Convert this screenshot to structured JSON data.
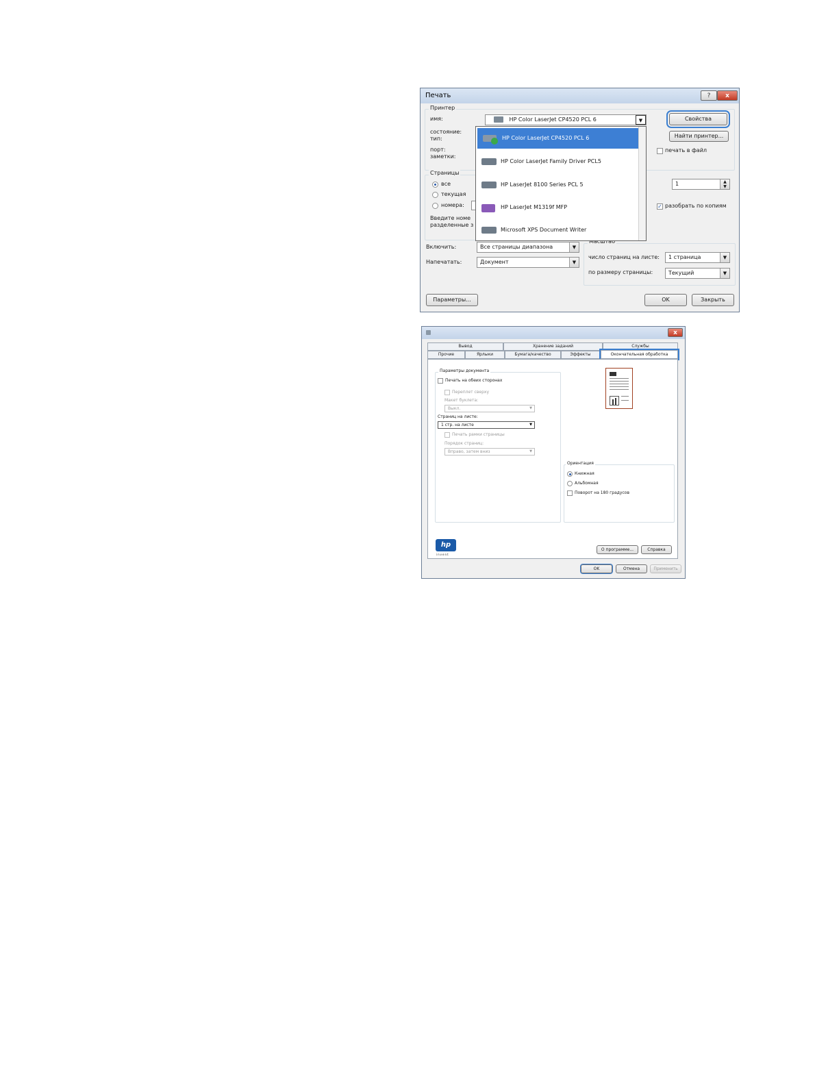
{
  "print_dialog": {
    "title": "Печать",
    "help_button": "?",
    "close_button": "x",
    "printer_group": "Принтер",
    "name_label": "имя:",
    "status_label": "состояние:",
    "type_label": "тип:",
    "port_label": "порт:",
    "notes_label": "заметки:",
    "selected_printer": "HP Color LaserJet CP4520 PCL 6",
    "properties_button": "Свойства",
    "find_printer_button": "Найти принтер...",
    "print_to_file": "печать в файл",
    "pages_group": "Страницы",
    "pages_all": "все",
    "pages_current": "текущая",
    "pages_numbers": "номера:",
    "hint_line1": "Введите номе",
    "hint_line2": "разделенные з",
    "copies_value": "1",
    "collate": "разобрать по копиям",
    "include_label": "Включить:",
    "include_value": "Все страницы диапазона",
    "print_what_label": "Напечатать:",
    "print_what_value": "Документ",
    "scale_group": "Масштаб",
    "pages_per_sheet_label": "число страниц на листе:",
    "pages_per_sheet_value": "1 страница",
    "fit_to_label": "по размеру страницы:",
    "fit_to_value": "Текущий",
    "options_button": "Параметры...",
    "ok_button": "OK",
    "close_dialog_button": "Закрыть",
    "printer_list": [
      "HP Color LaserJet CP4520 PCL 6",
      "HP Color LaserJet Family Driver PCL5",
      "HP LaserJet 8100 Series PCL 5",
      "HP LaserJet M1319f MFP",
      "Microsoft XPS Document Writer"
    ]
  },
  "props_dialog": {
    "close_button": "x",
    "tabs_row1": [
      "Вывод",
      "Хранение заданий",
      "Службы"
    ],
    "tabs_row2": [
      "Прочие",
      "Ярлыки",
      "Бумага/качество",
      "Эффекты",
      "Окончательная обработка"
    ],
    "doc_params_group": "Параметры документа",
    "duplex": "Печать на обеих сторонах",
    "flip_up": "Переплет сверху",
    "booklet_label": "Макет буклета:",
    "booklet_value": "Выкл.",
    "pages_per_sheet_label": "Страниц на листе:",
    "pages_per_sheet_value": "1 стр. на листе",
    "print_borders": "Печать рамки страницы",
    "page_order_label": "Порядок страниц:",
    "page_order_value": "Вправо, затем вниз",
    "orientation_group": "Ориентация",
    "portrait": "Книжная",
    "landscape": "Альбомная",
    "rotate": "Поворот на 180 градусов",
    "about_button": "О программе...",
    "help_button": "Справка",
    "ok_button": "OK",
    "cancel_button": "Отмена",
    "apply_button": "Применить",
    "logo_text": "hp",
    "logo_subtext": "invent"
  },
  "colors": {
    "accent": "#3b7fd0",
    "selection": "#3d7fd4",
    "close_red": "#c23a24"
  }
}
